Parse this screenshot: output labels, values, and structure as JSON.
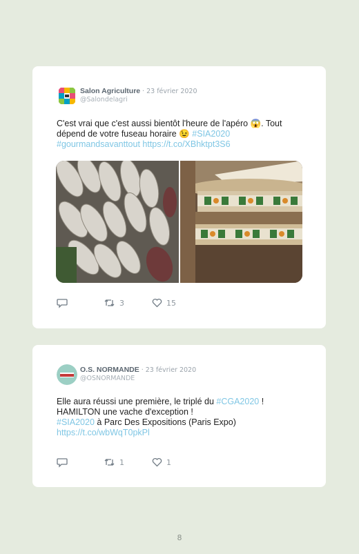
{
  "tweets": [
    {
      "author_name": "Salon Agriculture",
      "date": "· 23 février 2020",
      "handle": "@Salondelagri",
      "text": {
        "part1": "C'est vrai que c'est aussi bientôt l'heure de l'apéro ",
        "emoji1": "😱",
        "part2": ". Tout dépend de votre fuseau horaire ",
        "emoji2": "😉",
        "space": " ",
        "hashtag1": "#SIA2020",
        "hashtag2": "#gourmandsavanttout",
        "link": "https://t.co/XBhktpt3S6"
      },
      "media": [
        {
          "description": "dried sausages"
        },
        {
          "description": "Comté cheese wheels"
        }
      ],
      "actions": {
        "reply_icon": "reply-icon",
        "retweet_count": "3",
        "like_count": "15"
      }
    },
    {
      "author_name": "O.S. NORMANDE",
      "date": "· 23 février 2020",
      "handle": "@OSNORMANDE",
      "text": {
        "part1": "Elle aura réussi une première, le triplé du ",
        "hashtag1": "#CGA2020",
        "part2": " ! HAMILTON une vache d'exception !",
        "hashtag2": "#SIA2020",
        "part3": " à Parc Des Expositions (Paris Expo)",
        "link": "https://t.co/wbWqT0pkPl"
      },
      "actions": {
        "reply_icon": "reply-icon",
        "retweet_count": "1",
        "like_count": "1"
      }
    }
  ],
  "page_number": "8",
  "colors": {
    "background": "#e5ebdf",
    "card": "#ffffff",
    "link": "#7fc6e4",
    "name": "#5b6670"
  }
}
